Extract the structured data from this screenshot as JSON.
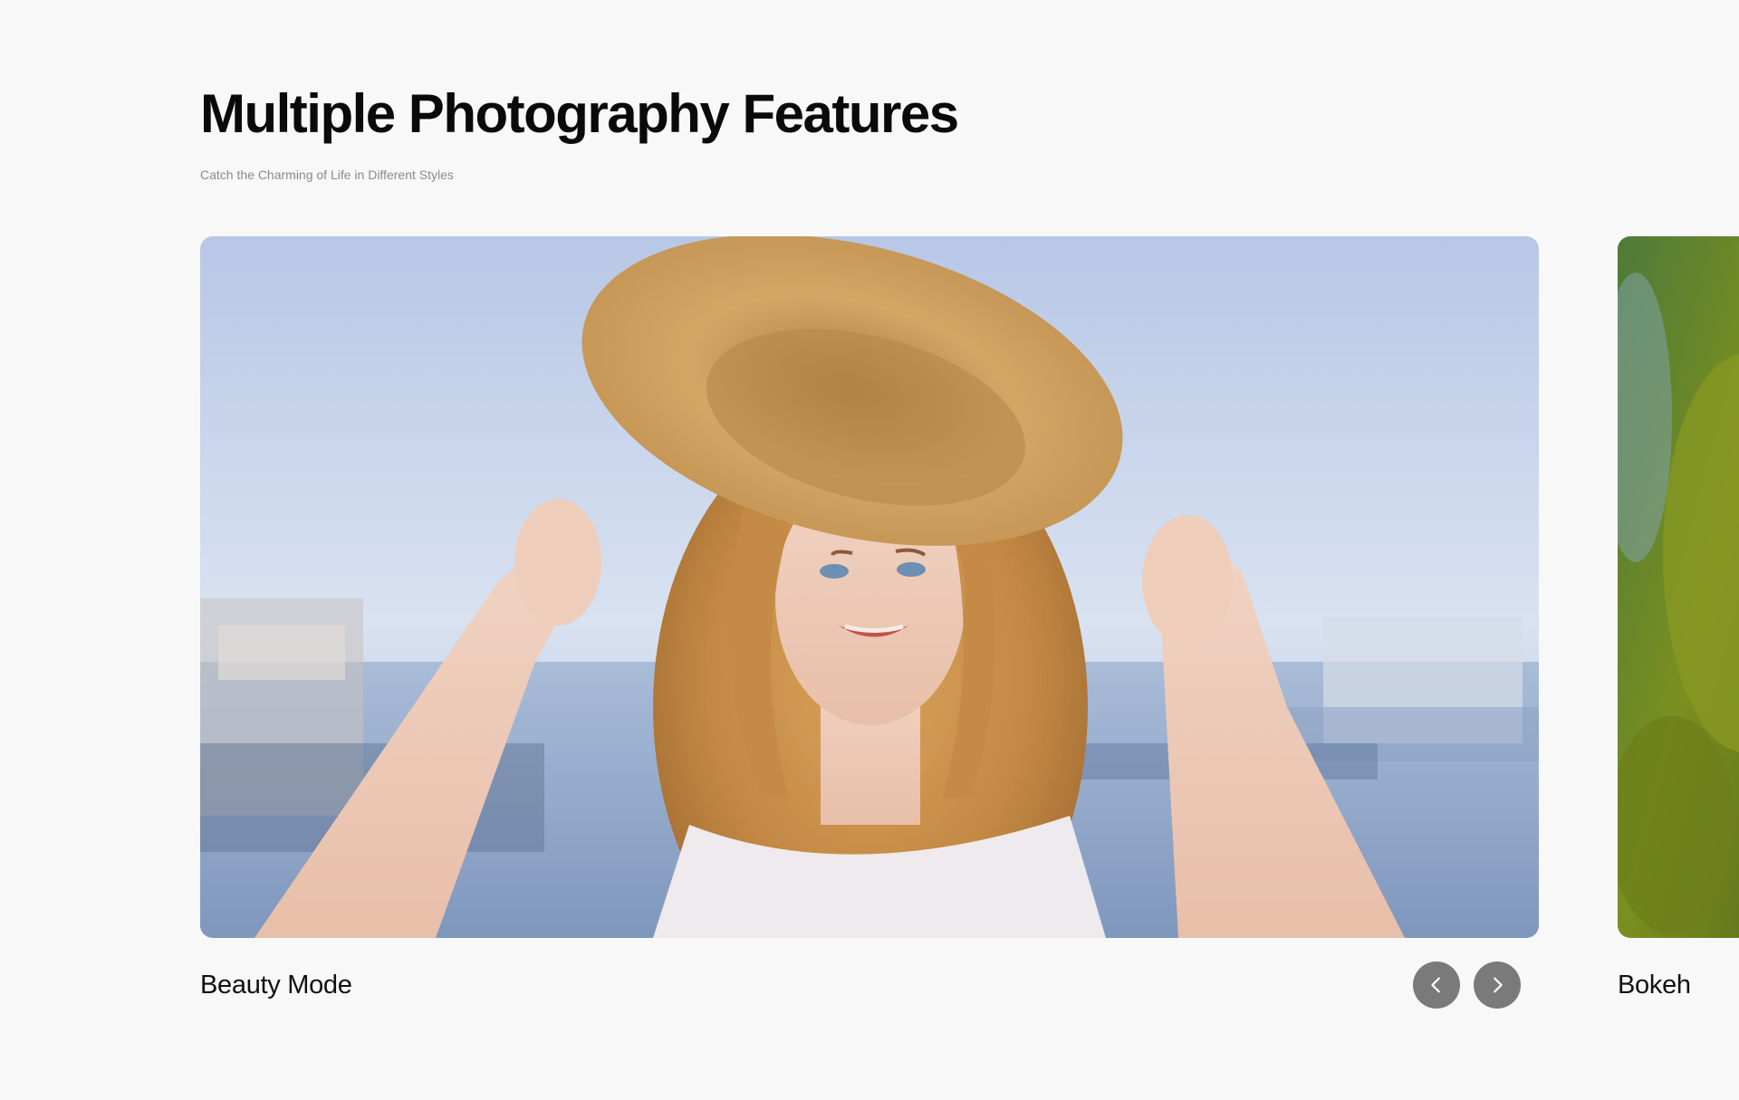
{
  "section": {
    "title": "Multiple Photography Features",
    "subtitle": "Catch the Charming of Life in Different Styles"
  },
  "carousel": {
    "slides": [
      {
        "label": "Beauty Mode",
        "image": "woman-in-straw-hat-at-harbor"
      },
      {
        "label": "Bokeh",
        "image": "blurred-green-foliage"
      }
    ],
    "controls": {
      "prev_icon": "chevron-left-icon",
      "next_icon": "chevron-right-icon"
    }
  },
  "colors": {
    "background": "#f8f8f8",
    "nav_button": "#7a7a7a",
    "subtitle_text": "#8a8a8a"
  }
}
